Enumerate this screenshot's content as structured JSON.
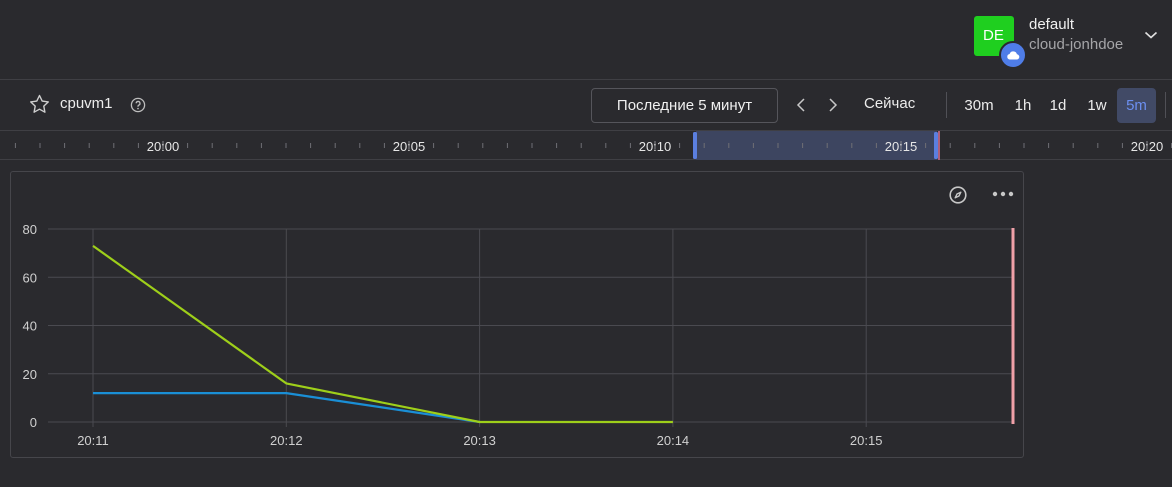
{
  "profile": {
    "avatar_initials": "DE",
    "name": "default",
    "cloud": "cloud-jonhdoe"
  },
  "toolbar": {
    "widget_name": "cpuvm1",
    "range_label": "Последние 5 минут",
    "now_label": "Сейчас",
    "presets": [
      {
        "label": "30m",
        "active": false
      },
      {
        "label": "1h",
        "active": false
      },
      {
        "label": "1d",
        "active": false
      },
      {
        "label": "1w",
        "active": false
      },
      {
        "label": "5m",
        "active": true
      }
    ]
  },
  "timeline": {
    "labels": [
      "20:00",
      "20:05",
      "20:10",
      "20:15",
      "20:20"
    ]
  },
  "chart_data": {
    "type": "line",
    "x": [
      "20:11",
      "20:12",
      "20:13",
      "20:14"
    ],
    "x_ticks": [
      "20:11",
      "20:12",
      "20:13",
      "20:14",
      "20:15"
    ],
    "y_ticks": [
      "0",
      "20",
      "40",
      "60",
      "80"
    ],
    "ylim": [
      0,
      80
    ],
    "grid": true,
    "series": [
      {
        "color": "#9ecf1a",
        "values": [
          73,
          16,
          0,
          0
        ]
      },
      {
        "color": "#1a8fd6",
        "values": [
          12,
          12,
          0,
          null
        ]
      }
    ],
    "now_marker_color": "#f0a0a8"
  }
}
